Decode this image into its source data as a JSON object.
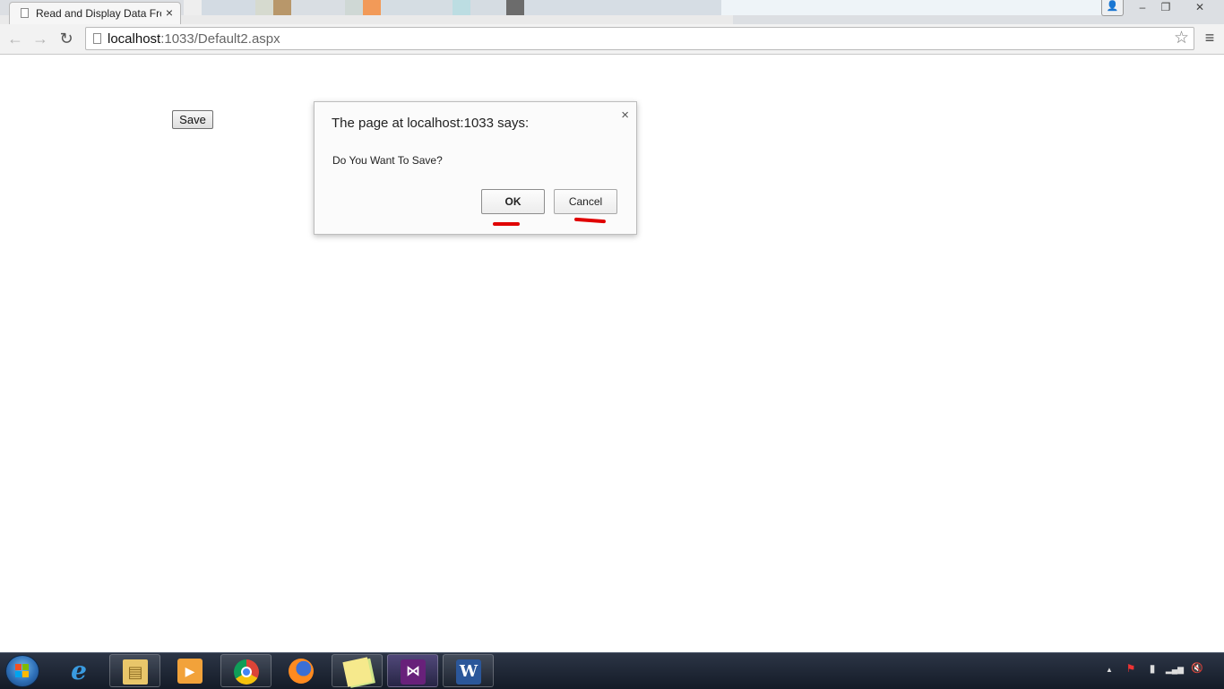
{
  "browser": {
    "tab_title": "Read and Display Data From",
    "tab_close": "×",
    "url_host": "localhost",
    "url_path": ":1033/Default2.aspx",
    "star": "☆",
    "menu": "≡",
    "window_minimize": "–",
    "window_restore": "❐",
    "window_close": "✕",
    "profile": "👤"
  },
  "page": {
    "save_label": "Save"
  },
  "dialog": {
    "heading": "The page at localhost:1033 says:",
    "message": "Do You Want To Save?",
    "close": "×",
    "ok_label": "OK",
    "cancel_label": "Cancel",
    "highlight_color": "#e00000"
  },
  "taskbar": {
    "apps": [
      {
        "name": "internet-explorer",
        "glyph": "e"
      },
      {
        "name": "file-explorer",
        "glyph": "▤"
      },
      {
        "name": "media-player",
        "glyph": "▶"
      },
      {
        "name": "chrome",
        "glyph": ""
      },
      {
        "name": "firefox",
        "glyph": ""
      },
      {
        "name": "sticky-notes",
        "glyph": ""
      },
      {
        "name": "visual-studio",
        "glyph": "⋈"
      },
      {
        "name": "word",
        "glyph": "W"
      }
    ],
    "tray_up_arrow": "▲",
    "tray_flag": "⚑",
    "tray_battery": "▮",
    "tray_signal": "▂▄▆",
    "tray_volume": "🔇"
  }
}
